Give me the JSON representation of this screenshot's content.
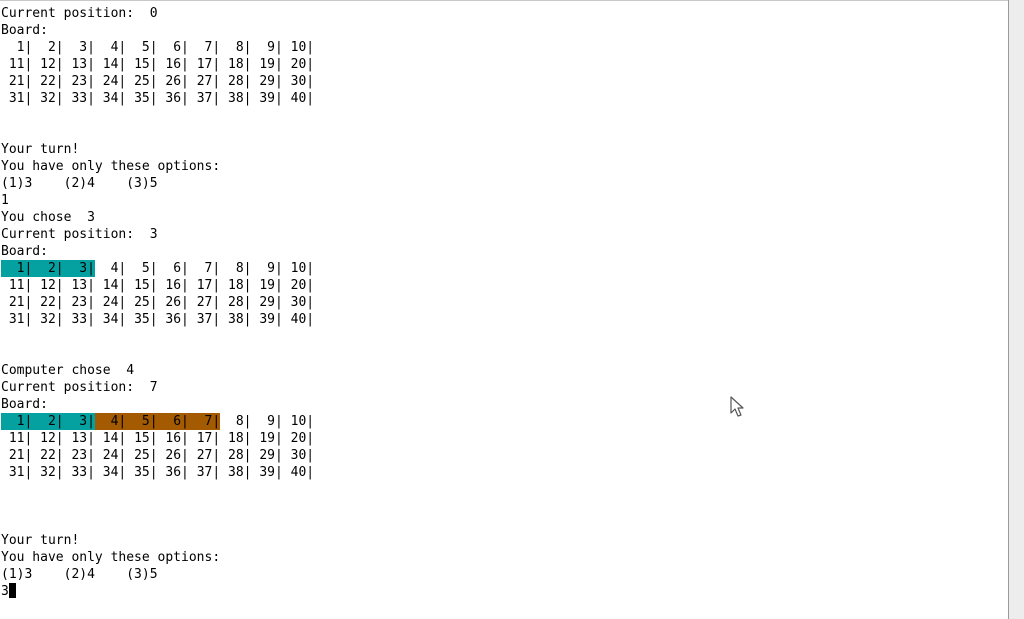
{
  "terminal": {
    "lines": [
      {
        "kind": "text",
        "text": "Current position:  0"
      },
      {
        "kind": "text",
        "text": "Board:"
      },
      {
        "kind": "cells",
        "cells": [
          {
            "text": "  1|",
            "state": "none"
          },
          {
            "text": "  2|",
            "state": "none"
          },
          {
            "text": "  3|",
            "state": "none"
          },
          {
            "text": "  4|",
            "state": "none"
          },
          {
            "text": "  5|",
            "state": "none"
          },
          {
            "text": "  6|",
            "state": "none"
          },
          {
            "text": "  7|",
            "state": "none"
          },
          {
            "text": "  8|",
            "state": "none"
          },
          {
            "text": "  9|",
            "state": "none"
          },
          {
            "text": " 10|",
            "state": "none"
          }
        ]
      },
      {
        "kind": "cells",
        "cells": [
          {
            "text": " 11|",
            "state": "none"
          },
          {
            "text": " 12|",
            "state": "none"
          },
          {
            "text": " 13|",
            "state": "none"
          },
          {
            "text": " 14|",
            "state": "none"
          },
          {
            "text": " 15|",
            "state": "none"
          },
          {
            "text": " 16|",
            "state": "none"
          },
          {
            "text": " 17|",
            "state": "none"
          },
          {
            "text": " 18|",
            "state": "none"
          },
          {
            "text": " 19|",
            "state": "none"
          },
          {
            "text": " 20|",
            "state": "none"
          }
        ]
      },
      {
        "kind": "cells",
        "cells": [
          {
            "text": " 21|",
            "state": "none"
          },
          {
            "text": " 22|",
            "state": "none"
          },
          {
            "text": " 23|",
            "state": "none"
          },
          {
            "text": " 24|",
            "state": "none"
          },
          {
            "text": " 25|",
            "state": "none"
          },
          {
            "text": " 26|",
            "state": "none"
          },
          {
            "text": " 27|",
            "state": "none"
          },
          {
            "text": " 28|",
            "state": "none"
          },
          {
            "text": " 29|",
            "state": "none"
          },
          {
            "text": " 30|",
            "state": "none"
          }
        ]
      },
      {
        "kind": "cells",
        "cells": [
          {
            "text": " 31|",
            "state": "none"
          },
          {
            "text": " 32|",
            "state": "none"
          },
          {
            "text": " 33|",
            "state": "none"
          },
          {
            "text": " 34|",
            "state": "none"
          },
          {
            "text": " 35|",
            "state": "none"
          },
          {
            "text": " 36|",
            "state": "none"
          },
          {
            "text": " 37|",
            "state": "none"
          },
          {
            "text": " 38|",
            "state": "none"
          },
          {
            "text": " 39|",
            "state": "none"
          },
          {
            "text": " 40|",
            "state": "none"
          }
        ]
      },
      {
        "kind": "text",
        "text": ""
      },
      {
        "kind": "text",
        "text": ""
      },
      {
        "kind": "text",
        "text": "Your turn!"
      },
      {
        "kind": "text",
        "text": "You have only these options:"
      },
      {
        "kind": "text",
        "text": "(1)3    (2)4    (3)5"
      },
      {
        "kind": "text",
        "text": "1"
      },
      {
        "kind": "text",
        "text": "You chose  3"
      },
      {
        "kind": "text",
        "text": "Current position:  3"
      },
      {
        "kind": "text",
        "text": "Board:"
      },
      {
        "kind": "cells",
        "cells": [
          {
            "text": "  1|",
            "state": "player"
          },
          {
            "text": "  2|",
            "state": "player"
          },
          {
            "text": "  3|",
            "state": "player"
          },
          {
            "text": "  4|",
            "state": "none"
          },
          {
            "text": "  5|",
            "state": "none"
          },
          {
            "text": "  6|",
            "state": "none"
          },
          {
            "text": "  7|",
            "state": "none"
          },
          {
            "text": "  8|",
            "state": "none"
          },
          {
            "text": "  9|",
            "state": "none"
          },
          {
            "text": " 10|",
            "state": "none"
          }
        ]
      },
      {
        "kind": "cells",
        "cells": [
          {
            "text": " 11|",
            "state": "none"
          },
          {
            "text": " 12|",
            "state": "none"
          },
          {
            "text": " 13|",
            "state": "none"
          },
          {
            "text": " 14|",
            "state": "none"
          },
          {
            "text": " 15|",
            "state": "none"
          },
          {
            "text": " 16|",
            "state": "none"
          },
          {
            "text": " 17|",
            "state": "none"
          },
          {
            "text": " 18|",
            "state": "none"
          },
          {
            "text": " 19|",
            "state": "none"
          },
          {
            "text": " 20|",
            "state": "none"
          }
        ]
      },
      {
        "kind": "cells",
        "cells": [
          {
            "text": " 21|",
            "state": "none"
          },
          {
            "text": " 22|",
            "state": "none"
          },
          {
            "text": " 23|",
            "state": "none"
          },
          {
            "text": " 24|",
            "state": "none"
          },
          {
            "text": " 25|",
            "state": "none"
          },
          {
            "text": " 26|",
            "state": "none"
          },
          {
            "text": " 27|",
            "state": "none"
          },
          {
            "text": " 28|",
            "state": "none"
          },
          {
            "text": " 29|",
            "state": "none"
          },
          {
            "text": " 30|",
            "state": "none"
          }
        ]
      },
      {
        "kind": "cells",
        "cells": [
          {
            "text": " 31|",
            "state": "none"
          },
          {
            "text": " 32|",
            "state": "none"
          },
          {
            "text": " 33|",
            "state": "none"
          },
          {
            "text": " 34|",
            "state": "none"
          },
          {
            "text": " 35|",
            "state": "none"
          },
          {
            "text": " 36|",
            "state": "none"
          },
          {
            "text": " 37|",
            "state": "none"
          },
          {
            "text": " 38|",
            "state": "none"
          },
          {
            "text": " 39|",
            "state": "none"
          },
          {
            "text": " 40|",
            "state": "none"
          }
        ]
      },
      {
        "kind": "text",
        "text": ""
      },
      {
        "kind": "text",
        "text": ""
      },
      {
        "kind": "text",
        "text": "Computer chose  4"
      },
      {
        "kind": "text",
        "text": "Current position:  7"
      },
      {
        "kind": "text",
        "text": "Board:"
      },
      {
        "kind": "cells",
        "cells": [
          {
            "text": "  1|",
            "state": "player"
          },
          {
            "text": "  2|",
            "state": "player"
          },
          {
            "text": "  3|",
            "state": "player"
          },
          {
            "text": "  4|",
            "state": "computer"
          },
          {
            "text": "  5|",
            "state": "computer"
          },
          {
            "text": "  6|",
            "state": "computer"
          },
          {
            "text": "  7|",
            "state": "computer"
          },
          {
            "text": "  8|",
            "state": "none"
          },
          {
            "text": "  9|",
            "state": "none"
          },
          {
            "text": " 10|",
            "state": "none"
          }
        ]
      },
      {
        "kind": "cells",
        "cells": [
          {
            "text": " 11|",
            "state": "none"
          },
          {
            "text": " 12|",
            "state": "none"
          },
          {
            "text": " 13|",
            "state": "none"
          },
          {
            "text": " 14|",
            "state": "none"
          },
          {
            "text": " 15|",
            "state": "none"
          },
          {
            "text": " 16|",
            "state": "none"
          },
          {
            "text": " 17|",
            "state": "none"
          },
          {
            "text": " 18|",
            "state": "none"
          },
          {
            "text": " 19|",
            "state": "none"
          },
          {
            "text": " 20|",
            "state": "none"
          }
        ]
      },
      {
        "kind": "cells",
        "cells": [
          {
            "text": " 21|",
            "state": "none"
          },
          {
            "text": " 22|",
            "state": "none"
          },
          {
            "text": " 23|",
            "state": "none"
          },
          {
            "text": " 24|",
            "state": "none"
          },
          {
            "text": " 25|",
            "state": "none"
          },
          {
            "text": " 26|",
            "state": "none"
          },
          {
            "text": " 27|",
            "state": "none"
          },
          {
            "text": " 28|",
            "state": "none"
          },
          {
            "text": " 29|",
            "state": "none"
          },
          {
            "text": " 30|",
            "state": "none"
          }
        ]
      },
      {
        "kind": "cells",
        "cells": [
          {
            "text": " 31|",
            "state": "none"
          },
          {
            "text": " 32|",
            "state": "none"
          },
          {
            "text": " 33|",
            "state": "none"
          },
          {
            "text": " 34|",
            "state": "none"
          },
          {
            "text": " 35|",
            "state": "none"
          },
          {
            "text": " 36|",
            "state": "none"
          },
          {
            "text": " 37|",
            "state": "none"
          },
          {
            "text": " 38|",
            "state": "none"
          },
          {
            "text": " 39|",
            "state": "none"
          },
          {
            "text": " 40|",
            "state": "none"
          }
        ]
      },
      {
        "kind": "text",
        "text": ""
      },
      {
        "kind": "text",
        "text": ""
      },
      {
        "kind": "text",
        "text": ""
      },
      {
        "kind": "text",
        "text": "Your turn!"
      },
      {
        "kind": "text",
        "text": "You have only these options:"
      },
      {
        "kind": "text",
        "text": "(1)3    (2)4    (3)5"
      },
      {
        "kind": "input",
        "text": "3"
      }
    ]
  },
  "colors": {
    "player_cell": "#05a1a1",
    "computer_cell": "#a35a00",
    "terminal_bg": "#ffffff",
    "terminal_fg": "#000000"
  },
  "icons": {
    "cursor": "text-cursor-block-icon",
    "mouse": "mouse-pointer-icon"
  }
}
